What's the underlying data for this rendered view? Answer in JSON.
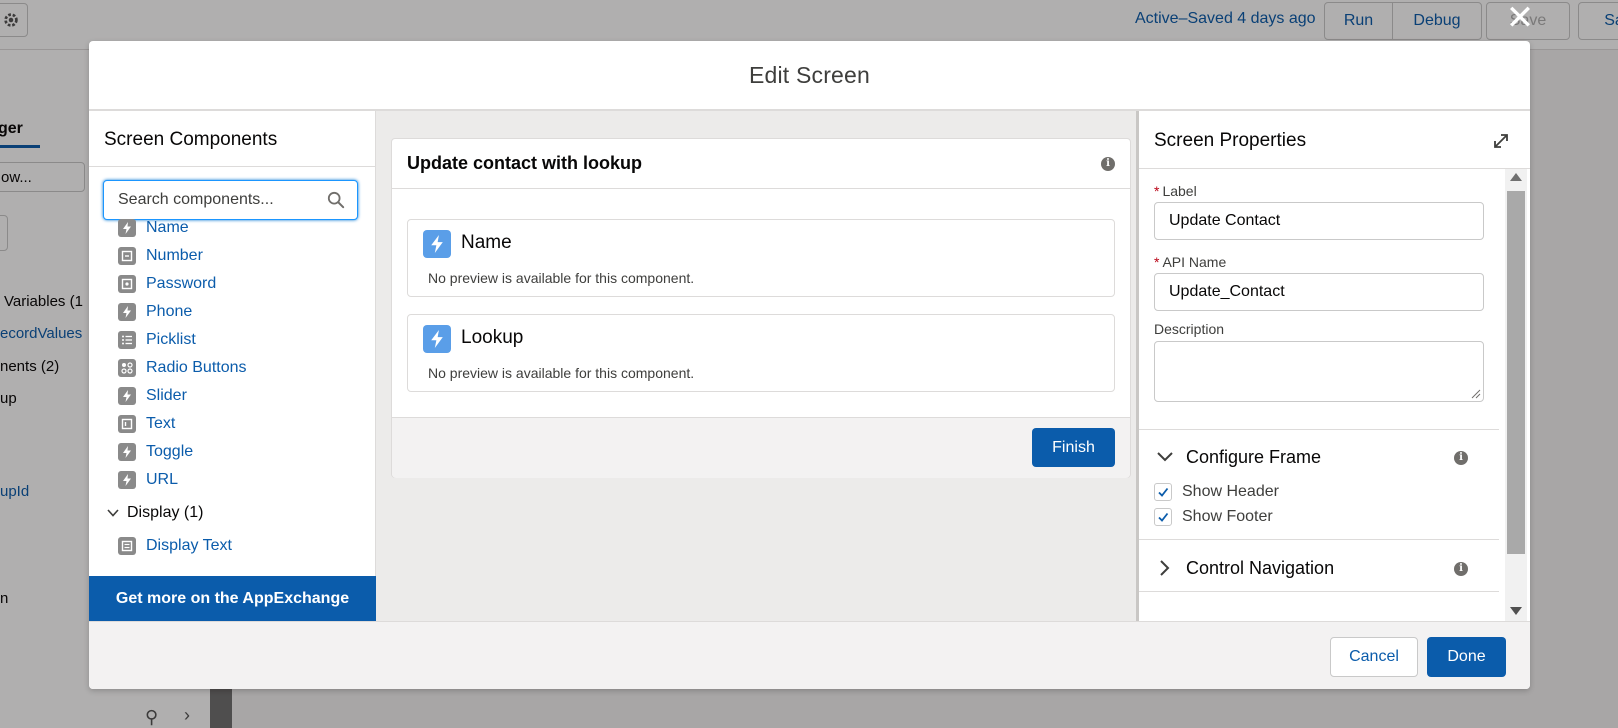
{
  "background": {
    "status": "Active–Saved 4 days ago",
    "buttons": {
      "run": "Run",
      "debug": "Debug",
      "save": "Save",
      "save_as": "Sav"
    },
    "left_fragments": {
      "tab": "ger",
      "search": "ow...",
      "variables": "Variables (1",
      "record_values": "ecordValues",
      "components": "nents (2)",
      "lookup": "up",
      "lookup_id": "upId",
      "misc": "n"
    }
  },
  "modal": {
    "title": "Edit Screen",
    "close_icon": "close-icon",
    "left_panel": {
      "title": "Screen Components",
      "search_placeholder": "Search components...",
      "items": [
        {
          "label": "Name",
          "icon": "lightning-icon"
        },
        {
          "label": "Number",
          "icon": "number-icon"
        },
        {
          "label": "Password",
          "icon": "password-icon"
        },
        {
          "label": "Phone",
          "icon": "lightning-icon"
        },
        {
          "label": "Picklist",
          "icon": "picklist-icon"
        },
        {
          "label": "Radio Buttons",
          "icon": "radio-icon"
        },
        {
          "label": "Slider",
          "icon": "lightning-icon"
        },
        {
          "label": "Text",
          "icon": "text-icon"
        },
        {
          "label": "Toggle",
          "icon": "lightning-icon"
        },
        {
          "label": "URL",
          "icon": "lightning-icon"
        }
      ],
      "display_section": {
        "label": "Display (1)",
        "items": [
          {
            "label": "Display Text",
            "icon": "display-text-icon"
          }
        ]
      },
      "appexchange_button": "Get more on the AppExchange"
    },
    "canvas": {
      "screen_title": "Update contact with lookup",
      "fields": [
        {
          "name": "Name",
          "preview": "No preview is available for this component."
        },
        {
          "name": "Lookup",
          "preview": "No preview is available for this component."
        }
      ],
      "finish_button": "Finish"
    },
    "properties": {
      "title": "Screen Properties",
      "label_field": {
        "label": "Label",
        "required_mark": "*",
        "value": "Update Contact"
      },
      "api_name_field": {
        "label": "API Name",
        "required_mark": "*",
        "value": "Update_Contact"
      },
      "description_field": {
        "label": "Description",
        "value": ""
      },
      "configure_frame": {
        "label": "Configure Frame",
        "show_header": {
          "label": "Show Header",
          "checked": true
        },
        "show_footer": {
          "label": "Show Footer",
          "checked": true
        }
      },
      "control_navigation": {
        "label": "Control Navigation"
      }
    },
    "footer": {
      "cancel": "Cancel",
      "done": "Done"
    }
  },
  "colors": {
    "brand": "#0b5cab",
    "field_icon": "#5a9ee8",
    "required": "#ba0517"
  }
}
